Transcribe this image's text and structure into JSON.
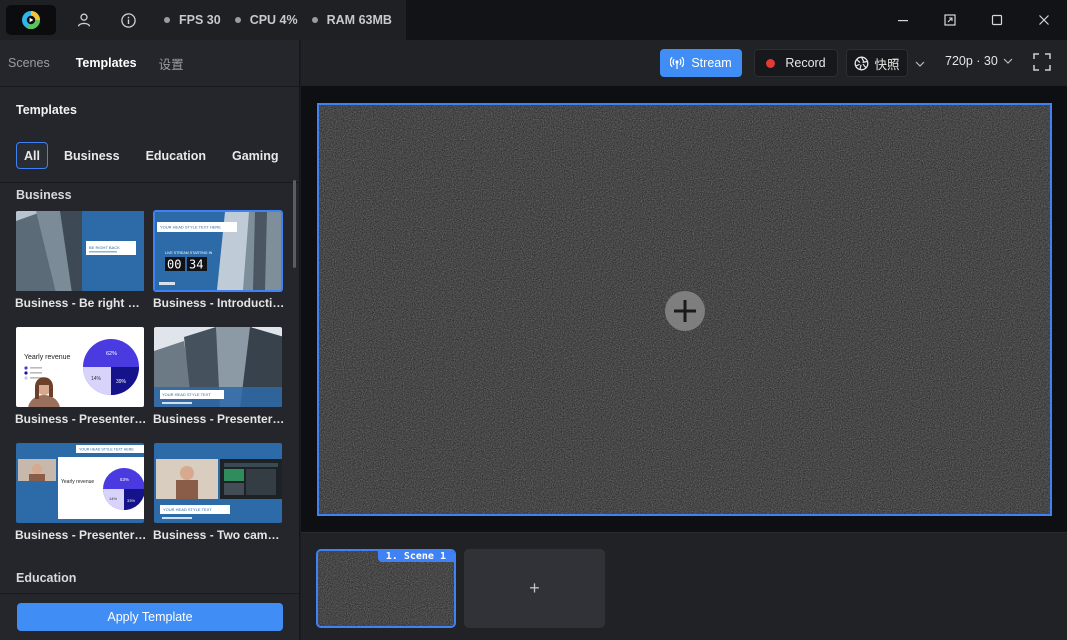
{
  "titlebar": {
    "stats": [
      {
        "label": "FPS 30"
      },
      {
        "label": "CPU 4%"
      },
      {
        "label": "RAM 63MB"
      }
    ]
  },
  "left_panel": {
    "tabs": [
      {
        "label": "Scenes",
        "active": false
      },
      {
        "label": "Templates",
        "active": true
      },
      {
        "label": "设置",
        "active": false
      }
    ],
    "title": "Templates",
    "filters": [
      {
        "label": "All",
        "active": true
      },
      {
        "label": "Business",
        "active": false
      },
      {
        "label": "Education",
        "active": false
      },
      {
        "label": "Gaming",
        "active": false
      }
    ],
    "sections": [
      {
        "label": "Business",
        "templates": [
          {
            "name": "Business - Be right back",
            "selected": false
          },
          {
            "name": "Business - Introduction",
            "selected": true
          },
          {
            "name": "Business - Presenter o...",
            "selected": false
          },
          {
            "name": "Business - Presenter o...",
            "selected": false
          },
          {
            "name": "Business - Presenter s...",
            "selected": false
          },
          {
            "name": "Business - Two camer...",
            "selected": false
          }
        ]
      },
      {
        "label": "Education",
        "templates": []
      }
    ],
    "apply_label": "Apply Template"
  },
  "thumb_text": {
    "brb_title": "BE RIGHT BACK",
    "head_title": "YOUR HEAD STYLE TEXT HERE",
    "starting": "LIVE STREAM STARTING IN",
    "timer_min": "00",
    "timer_sec": "34",
    "yearly_revenue": "Yearly revenue",
    "pie_labels": [
      "62%",
      "14%",
      "39%"
    ],
    "pie_labels_small": [
      "53%",
      "14%",
      "33%"
    ],
    "lower_title": "YOUR HEAD STYLE TEXT"
  },
  "toolbar": {
    "stream_label": "Stream",
    "record_label": "Record",
    "snapshot_label": "快照",
    "resolution": "720p · 30"
  },
  "scenes": [
    {
      "label": "1. Scene 1",
      "active": true
    }
  ],
  "add_scene_label": "+",
  "colors": {
    "accent": "#3f8df5",
    "record": "#e53935",
    "background": "#1b1c20"
  }
}
